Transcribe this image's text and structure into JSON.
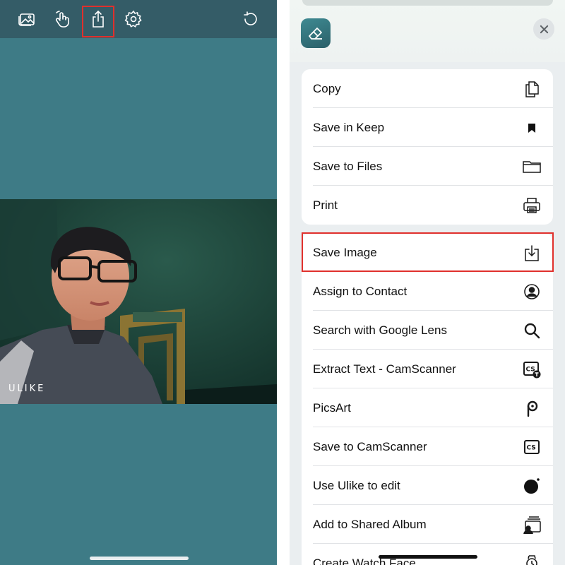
{
  "editor": {
    "toolbar": {
      "items": [
        {
          "name": "gallery",
          "icon": "gallery-icon"
        },
        {
          "name": "gesture",
          "icon": "hand-tap-icon"
        },
        {
          "name": "share",
          "icon": "share-icon",
          "highlighted": true
        },
        {
          "name": "settings",
          "icon": "gear-icon"
        },
        {
          "name": "reset",
          "icon": "rotate-ccw-icon"
        }
      ]
    },
    "photo": {
      "watermark": "ULIKE"
    }
  },
  "share_sheet": {
    "app_icon": "eraser-icon",
    "close_icon": "close-icon",
    "group1": [
      {
        "label": "Copy",
        "icon": "copy-icon"
      },
      {
        "label": "Save in Keep",
        "icon": "bookmark-icon"
      },
      {
        "label": "Save to Files",
        "icon": "folder-icon"
      },
      {
        "label": "Print",
        "icon": "printer-icon"
      }
    ],
    "group2": [
      {
        "label": "Save Image",
        "icon": "download-icon",
        "highlighted": true
      },
      {
        "label": "Assign to Contact",
        "icon": "contact-icon"
      },
      {
        "label": "Search with Google Lens",
        "icon": "search-icon"
      },
      {
        "label": "Extract Text - CamScanner",
        "icon": "camscanner-text-icon"
      },
      {
        "label": "PicsArt",
        "icon": "picsart-icon"
      },
      {
        "label": "Save to CamScanner",
        "icon": "camscanner-icon"
      },
      {
        "label": "Use Ulike to edit",
        "icon": "ulike-icon"
      },
      {
        "label": "Add to Shared Album",
        "icon": "shared-album-icon"
      },
      {
        "label": "Create Watch Face",
        "icon": "watch-icon"
      }
    ]
  },
  "colors": {
    "canvas": "#3e7b86",
    "toolbar": "#345c67",
    "highlight": "#e0302c",
    "sheet_bg": "#eaeef0"
  }
}
